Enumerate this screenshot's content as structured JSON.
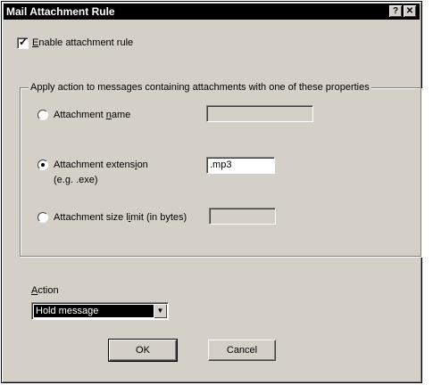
{
  "window": {
    "title": "Mail Attachment Rule",
    "help_glyph": "?",
    "close_glyph": "✕"
  },
  "enable": {
    "checked": true,
    "check_glyph": "✓",
    "label_before": "",
    "label_underline": "E",
    "label_after": "nable attachment rule"
  },
  "group": {
    "legend": "Apply action to messages containing attachments with one of these properties",
    "options": [
      {
        "label_before": "Attachment ",
        "label_underline": "n",
        "label_after": "ame",
        "selected": false,
        "value": "",
        "enabled": false
      },
      {
        "label_before": "Attachment extens",
        "label_underline": "i",
        "label_after": "on",
        "hint": "(e.g.  .exe)",
        "selected": true,
        "value": ".mp3",
        "enabled": true
      },
      {
        "label_before": "Attachment size l",
        "label_underline": "i",
        "label_after": "mit (in bytes)",
        "selected": false,
        "value": "",
        "enabled": false
      }
    ]
  },
  "action": {
    "label_underline": "A",
    "label_after": "ction",
    "selected": "Hold message",
    "arrow_glyph": "▼"
  },
  "buttons": {
    "ok": "OK",
    "cancel": "Cancel"
  }
}
